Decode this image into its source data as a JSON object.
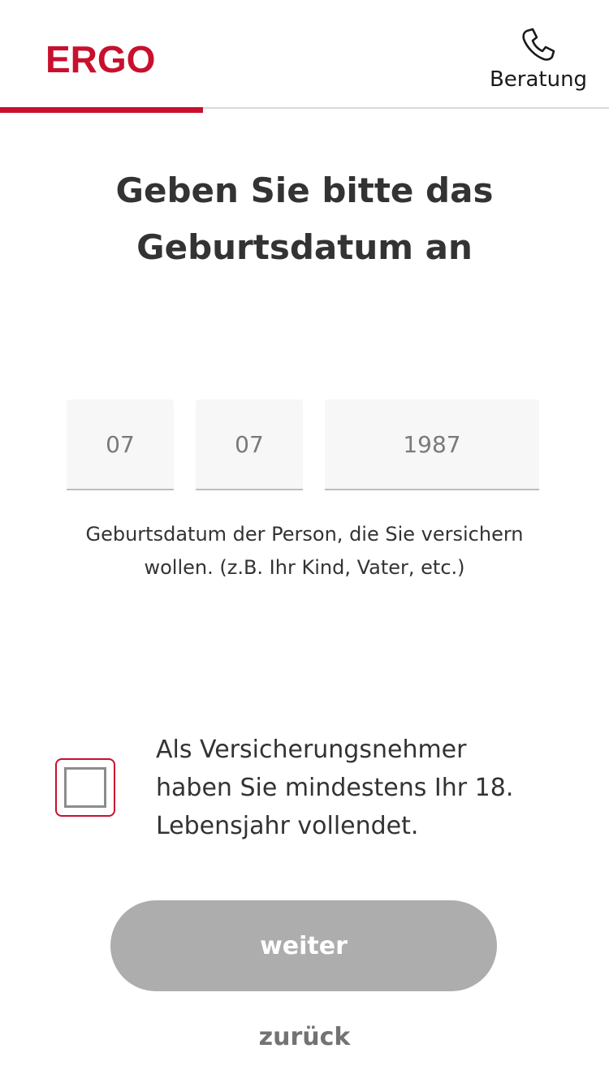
{
  "header": {
    "logo_text": "ERGO",
    "beratung_label": "Beratung",
    "beratung_icon": "phone-icon"
  },
  "progress": {
    "fraction": 0.333
  },
  "main": {
    "title_line1": "Geben Sie bitte das",
    "title_line2": "Geburtsdatum an",
    "day_value": "07",
    "month_value": "07",
    "year_value": "1987",
    "hint_line1": "Geburtsdatum der Person, die Sie versichern",
    "hint_line2": "wollen. (z.B. Ihr Kind, Vater, etc.)",
    "checkbox_checked": false,
    "checkbox_line1": "Als Versicherungsnehmer",
    "checkbox_line2": "haben Sie mindestens Ihr 18.",
    "checkbox_line3": "Lebensjahr vollendet."
  },
  "footer": {
    "weiter_label": "weiter",
    "zurueck_label": "zurück"
  },
  "colors": {
    "brand_red": "#c8102e",
    "button_disabled": "#adadad",
    "text_dark": "#333333"
  }
}
